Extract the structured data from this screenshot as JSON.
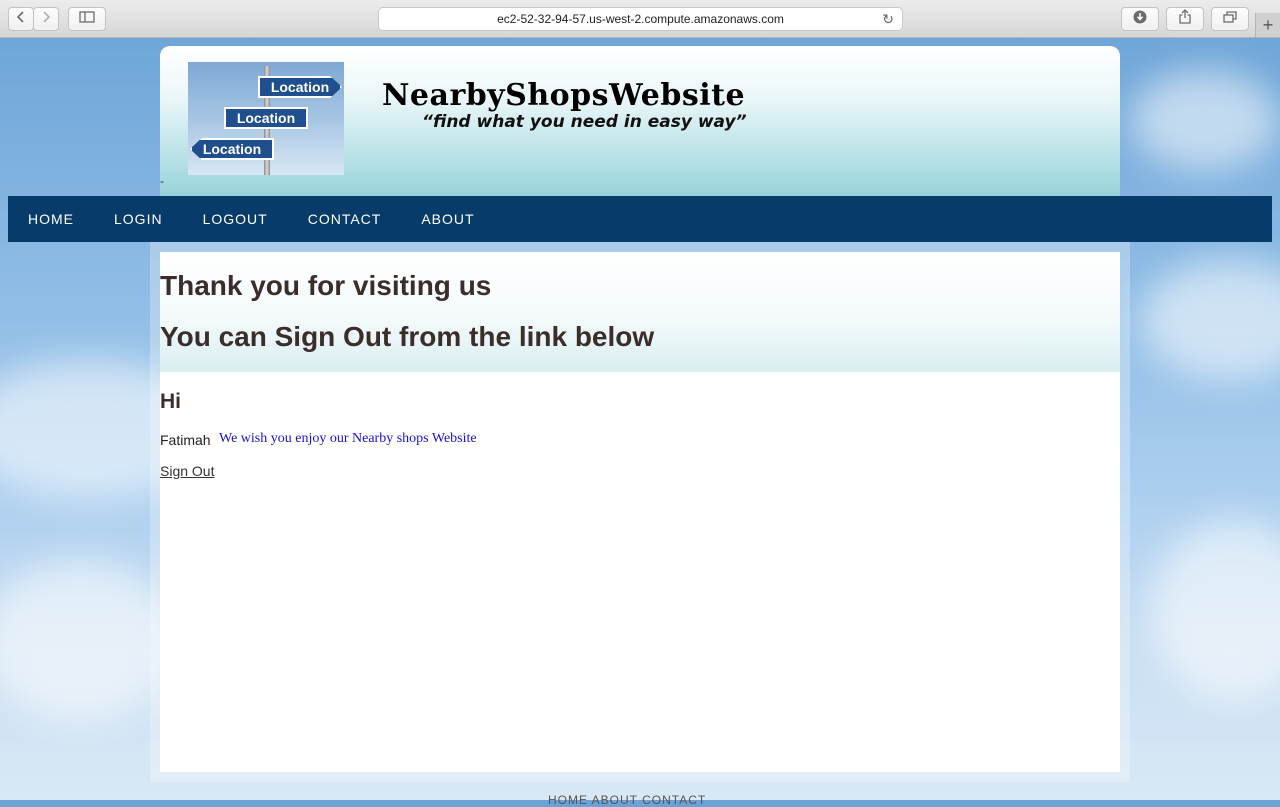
{
  "browser": {
    "url": "ec2-52-32-94-57.us-west-2.compute.amazonaws.com",
    "back_icon": "chevron-left-icon",
    "forward_icon": "chevron-right-icon",
    "sidebar_icon": "sidebar-icon",
    "reload_icon": "reload-icon",
    "download_icon": "download-icon",
    "share_icon": "share-icon",
    "tabs_icon": "tabs-icon",
    "new_tab_label": "+"
  },
  "header": {
    "logo_signs": [
      "Location",
      "Location",
      "Location"
    ],
    "site_title": "NearbyShopsWebsite",
    "tagline": "“find what you need in easy way”",
    "stray_text": "-"
  },
  "nav": {
    "items": [
      {
        "label": "HOME"
      },
      {
        "label": "LOGIN"
      },
      {
        "label": "LOGOUT"
      },
      {
        "label": "CONTACT"
      },
      {
        "label": "ABOUT"
      }
    ]
  },
  "main": {
    "heading1": "Thank you for visiting us",
    "heading2": "You can Sign Out from the link below",
    "greeting": "Hi",
    "username": "Fatimah",
    "wish_text": "We wish you enjoy our Nearby shops Website",
    "signout_link": "Sign Out"
  },
  "footer": {
    "peek_text": "HOME ABOUT CONTACT"
  },
  "colors": {
    "nav_bg": "#073c6a",
    "heading": "#3b2d2a",
    "wish_text": "#1a10d6"
  }
}
